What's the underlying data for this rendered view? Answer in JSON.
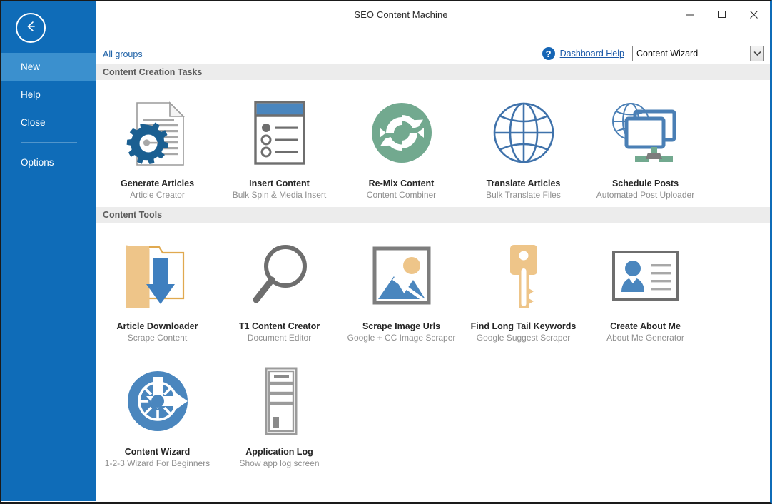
{
  "window": {
    "title": "SEO Content Machine",
    "controls": {
      "minimize": "minimize-icon",
      "maximize": "maximize-icon",
      "close": "close-icon"
    },
    "accent_color": "#0f6cb8"
  },
  "sidebar": {
    "back_icon": "back-arrow-icon",
    "items": [
      {
        "label": "New",
        "active": true
      },
      {
        "label": "Help",
        "active": false
      },
      {
        "label": "Close",
        "active": false
      },
      {
        "label": "Options",
        "active": false
      }
    ]
  },
  "toolbar": {
    "all_groups_label": "All groups",
    "help_icon": "question-mark-icon",
    "help_link_label": "Dashboard Help",
    "dropdown": {
      "value": "Content Wizard",
      "arrow_icon": "chevron-down-icon"
    }
  },
  "sections": [
    {
      "header": "Content Creation Tasks",
      "tiles": [
        {
          "title": "Generate Articles",
          "subtitle": "Article Creator",
          "icon": "document-gear-icon"
        },
        {
          "title": "Insert Content",
          "subtitle": "Bulk Spin & Media Insert",
          "icon": "list-window-icon"
        },
        {
          "title": "Re-Mix Content",
          "subtitle": "Content Combiner",
          "icon": "refresh-circle-icon"
        },
        {
          "title": "Translate Articles",
          "subtitle": "Bulk Translate Files",
          "icon": "globe-icon"
        },
        {
          "title": "Schedule Posts",
          "subtitle": "Automated Post Uploader",
          "icon": "globe-monitor-network-icon"
        }
      ]
    },
    {
      "header": "Content Tools",
      "tiles": [
        {
          "title": "Article Downloader",
          "subtitle": "Scrape Content",
          "icon": "folder-download-icon"
        },
        {
          "title": "T1 Content Creator",
          "subtitle": "Document Editor",
          "icon": "magnifier-icon"
        },
        {
          "title": "Scrape Image Urls",
          "subtitle": "Google + CC Image Scraper",
          "icon": "picture-icon"
        },
        {
          "title": "Find Long Tail Keywords",
          "subtitle": "Google Suggest Scraper",
          "icon": "key-icon"
        },
        {
          "title": "Create About Me",
          "subtitle": "About Me Generator",
          "icon": "contact-card-icon"
        },
        {
          "title": "Content Wizard",
          "subtitle": "1-2-3 Wizard For Beginners",
          "icon": "donut-arrow-icon"
        },
        {
          "title": "Application Log",
          "subtitle": "Show app log screen",
          "icon": "server-tower-icon"
        }
      ]
    }
  ],
  "colors": {
    "sidebar_blue": "#0f6cb8",
    "sidebar_active_blue": "#3b90ce",
    "header_gray": "#ececec",
    "icon_dark_blue": "#1b5f91",
    "icon_medium_blue": "#4a86be",
    "icon_green": "#72a98f",
    "icon_tan": "#eec589",
    "icon_gray": "#6e6e6e"
  }
}
